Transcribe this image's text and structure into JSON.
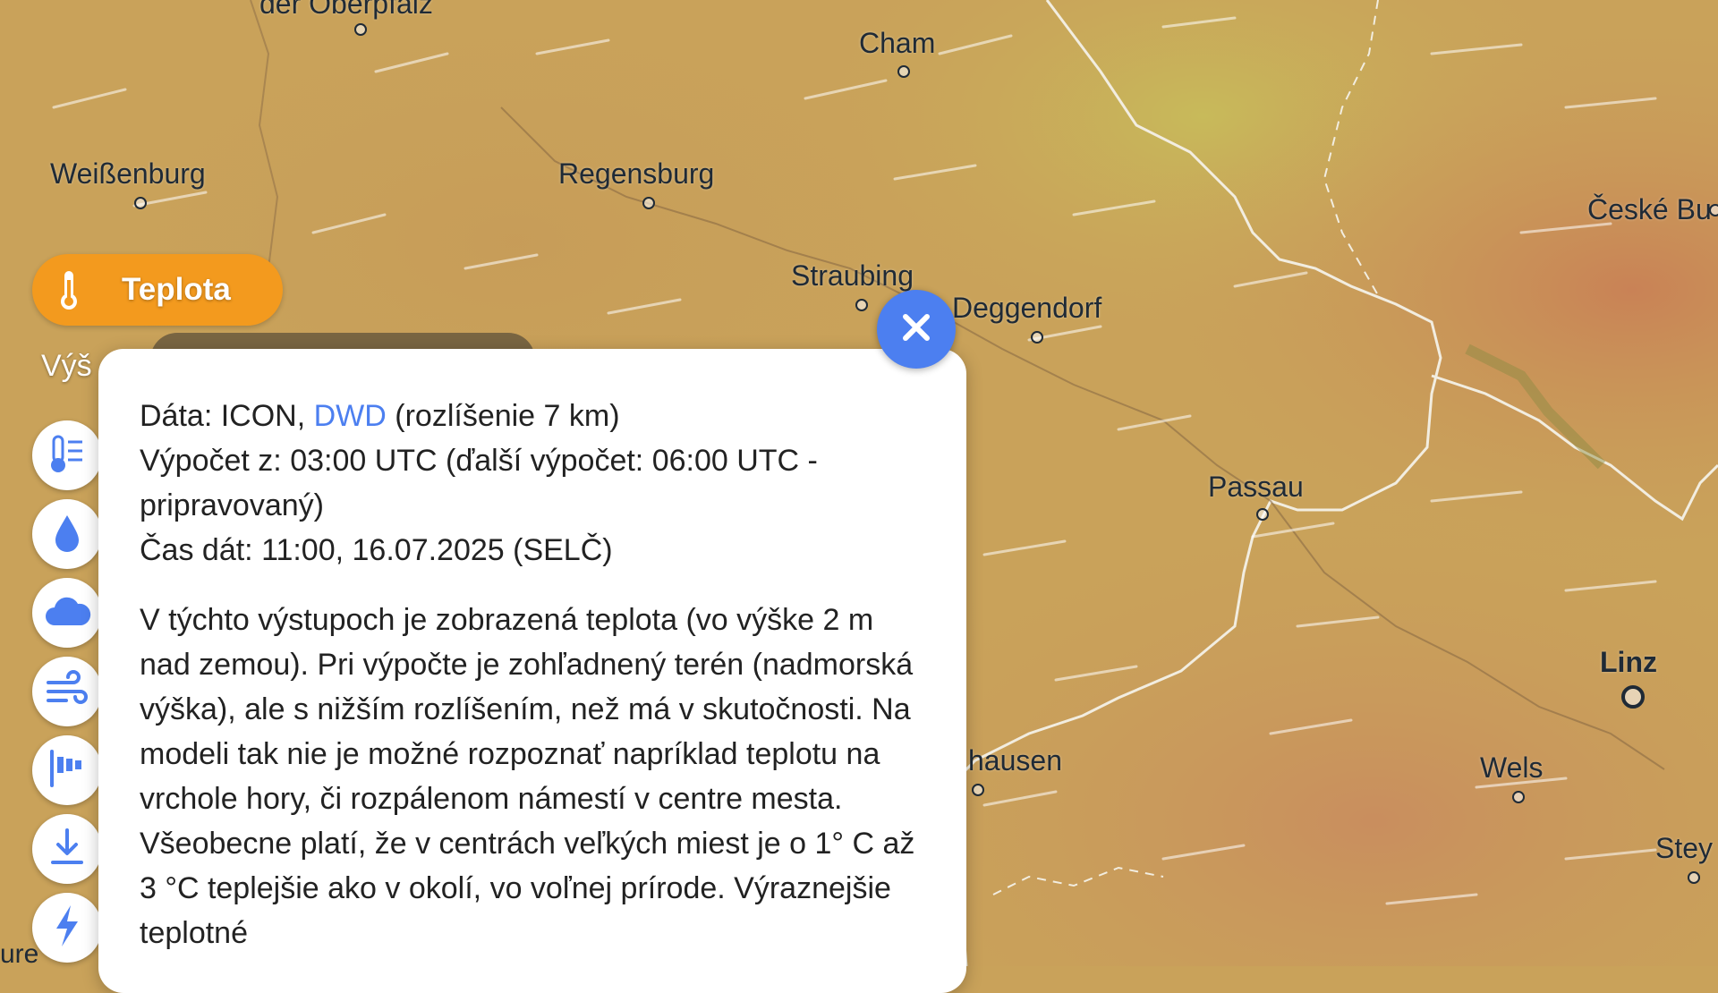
{
  "map": {
    "cities": [
      {
        "name": "der Oberpfalz",
        "style": "normal"
      },
      {
        "name": "Cham",
        "style": "normal"
      },
      {
        "name": "Weißenburg",
        "style": "normal"
      },
      {
        "name": "Regensburg",
        "style": "normal"
      },
      {
        "name": "Straubing",
        "style": "normal"
      },
      {
        "name": "Deggendorf",
        "style": "normal"
      },
      {
        "name": "České Bu",
        "style": "normal"
      },
      {
        "name": "Passau",
        "style": "normal"
      },
      {
        "name": "Linz",
        "style": "bold"
      },
      {
        "name": "hausen",
        "style": "normal"
      },
      {
        "name": "Wels",
        "style": "normal"
      },
      {
        "name": "Stey",
        "style": "normal"
      }
    ],
    "left_edge_text": "ure",
    "colors": {
      "base": "#c9a25a",
      "warm": "#c98a5a",
      "cool": "#b8b85a"
    }
  },
  "layer": {
    "label": "Teplota",
    "icon": "thermometer-icon",
    "color": "#f39a1e"
  },
  "height_label": "Výš",
  "tools": [
    {
      "name": "temperature-list-icon"
    },
    {
      "name": "drop-icon"
    },
    {
      "name": "cloud-icon"
    },
    {
      "name": "wind-icon"
    },
    {
      "name": "wind-gust-icon"
    },
    {
      "name": "download-icon"
    },
    {
      "name": "lightning-icon"
    }
  ],
  "info": {
    "data_prefix": "Dáta: ICON, ",
    "data_link": "DWD",
    "data_suffix": " (rozlíšenie 7 km)",
    "calc_line": "Výpočet z: 03:00 UTC (ďalší výpočet: 06:00 UTC - pripravovaný)",
    "time_line": "Čas dát: 11:00, 16.07.2025 (SELČ)",
    "description": "V týchto výstupoch je zobrazená teplota (vo výške 2 m nad zemou). Pri výpočte je zohľadnený terén (nadmorská výška), ale s nižším rozlíšením, než má v skutočnosti. Na modeli tak nie je možné rozpoznať napríklad teplotu na vrchole hory, či rozpálenom námestí v centre mesta. Všeobecne platí, že v centrách veľkých miest je o 1° C až 3 °C teplejšie ako v okolí, vo voľnej prírode. Výraznejšie teplotné",
    "link_color": "#4c7ff0"
  },
  "close_icon": "close-icon"
}
